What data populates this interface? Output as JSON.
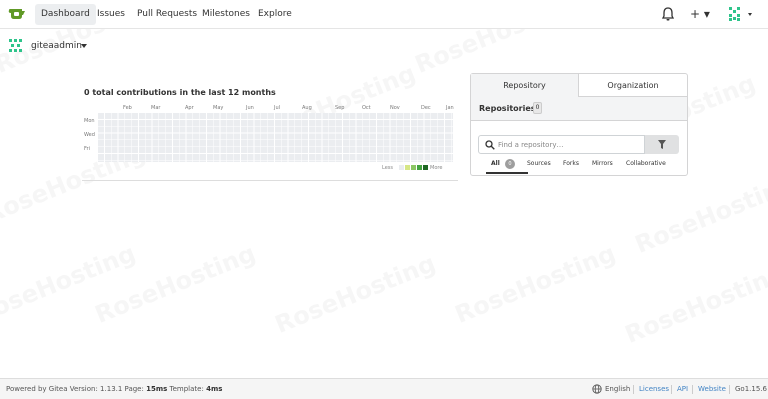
{
  "nav": {
    "items": [
      {
        "label": "Dashboard",
        "active": true
      },
      {
        "label": "Issues",
        "active": false
      },
      {
        "label": "Pull Requests",
        "active": false
      },
      {
        "label": "Milestones",
        "active": false
      },
      {
        "label": "Explore",
        "active": false
      }
    ],
    "plus": "+ ▾"
  },
  "user": {
    "name": "giteaadmin"
  },
  "heatmap": {
    "title": "0 total contributions in the last 12 months",
    "months": [
      "Feb",
      "Mar",
      "Apr",
      "May",
      "Jun",
      "Jul",
      "Aug",
      "Sep",
      "Oct",
      "Nov",
      "Dec",
      "Jan"
    ],
    "days": [
      "Mon",
      "Wed",
      "Fri"
    ],
    "legend_less": "Less",
    "legend_more": "More",
    "legend_colors": [
      "#ebedf0",
      "#d6e685",
      "#8cc665",
      "#44a340",
      "#1e6823"
    ],
    "total": 0
  },
  "side": {
    "tabs": [
      {
        "label": "Repository",
        "active": true
      },
      {
        "label": "Organization",
        "active": false
      }
    ],
    "repos_title": "Repositories",
    "repos_count": "0",
    "search_placeholder": "Find a repository…",
    "filters": [
      {
        "label": "All",
        "active": true,
        "badge": "0"
      },
      {
        "label": "Sources"
      },
      {
        "label": "Forks"
      },
      {
        "label": "Mirrors"
      },
      {
        "label": "Collaborative"
      }
    ]
  },
  "footer": {
    "powered": "Powered by Gitea Version: 1.13.1 Page:",
    "page_time": "15ms",
    "template_label": "Template:",
    "template_time": "4ms",
    "language": "English",
    "links": [
      "Licenses",
      "API",
      "Website"
    ],
    "go_version": "Go1.15.6"
  },
  "colors": {
    "accent": "#609926",
    "link": "#4183c4",
    "nav_active_bg": "#eceef0"
  },
  "watermark": "RoseHosting"
}
